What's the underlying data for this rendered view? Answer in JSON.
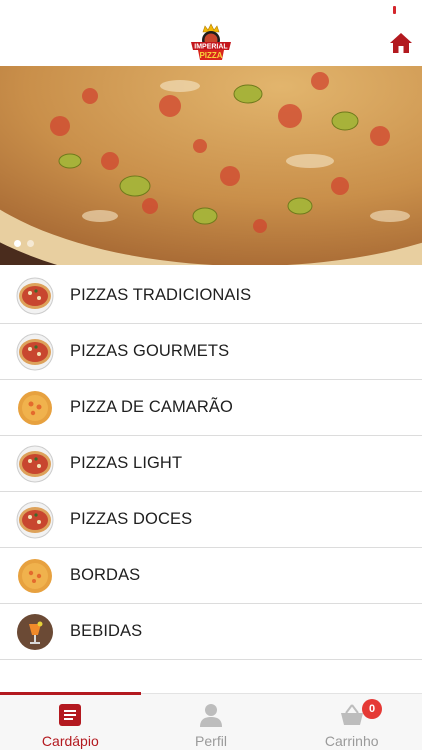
{
  "header": {
    "logo_brand": "IMPERIAL",
    "logo_product": "PIZZA",
    "home_icon": "home-icon",
    "accent_color": "#b3191f"
  },
  "hero": {
    "slide_count": 2,
    "active_slide": 1
  },
  "menu": {
    "items": [
      {
        "label": "PIZZAS TRADICIONAIS",
        "icon": "pizza-icon"
      },
      {
        "label": "PIZZAS GOURMETS",
        "icon": "pizza-icon"
      },
      {
        "label": "PIZZA DE CAMARÃO",
        "icon": "shrimp-pizza-icon"
      },
      {
        "label": "PIZZAS LIGHT",
        "icon": "pizza-icon"
      },
      {
        "label": "PIZZAS DOCES",
        "icon": "pizza-icon"
      },
      {
        "label": "BORDAS",
        "icon": "pizza-crust-icon"
      },
      {
        "label": "BEBIDAS",
        "icon": "drink-icon"
      }
    ]
  },
  "tabs": {
    "items": [
      {
        "label": "Cardápio",
        "icon": "menu-list-icon",
        "active": true
      },
      {
        "label": "Perfil",
        "icon": "user-icon",
        "active": false
      },
      {
        "label": "Carrinho",
        "icon": "cart-icon",
        "active": false
      }
    ],
    "cart_count": "0"
  }
}
